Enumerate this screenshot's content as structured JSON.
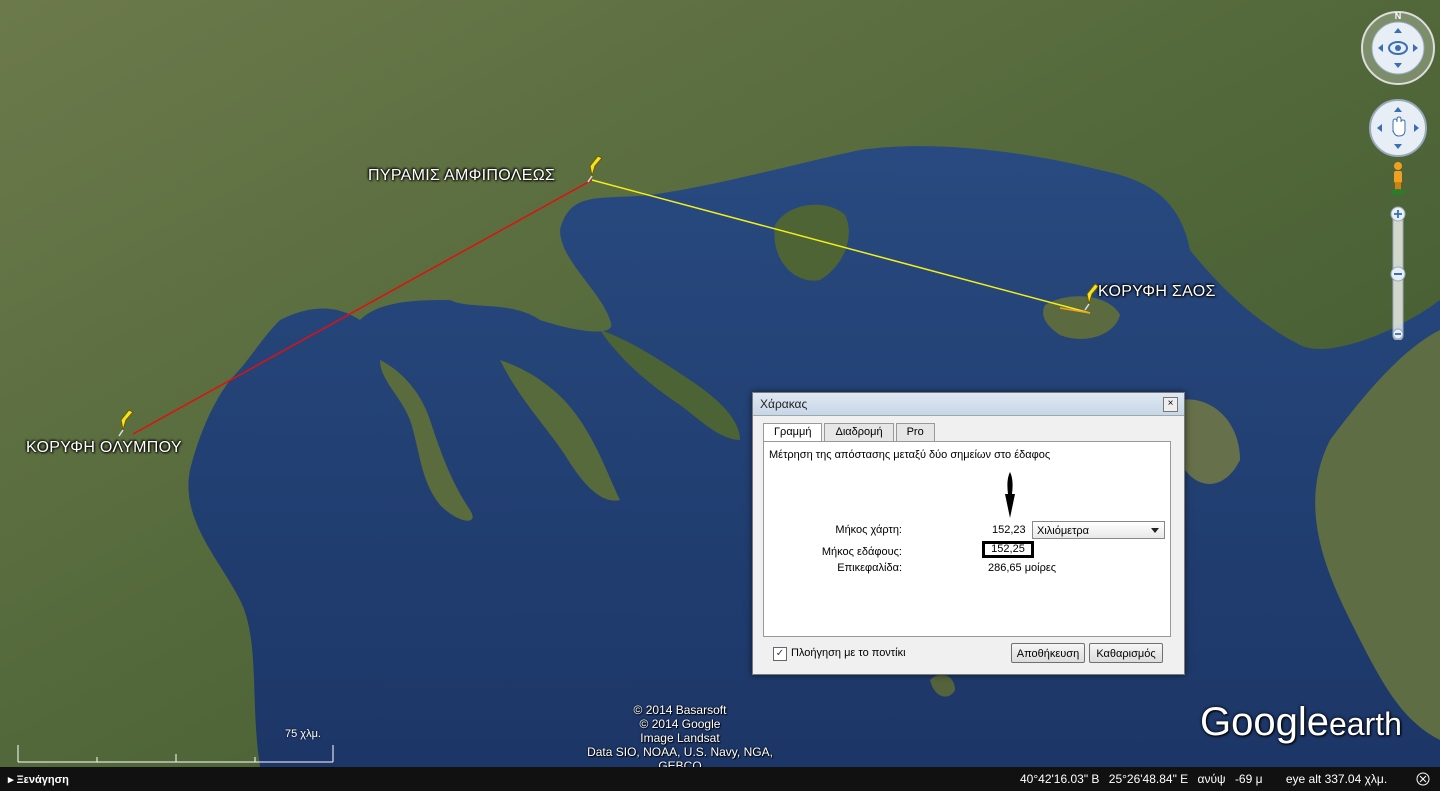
{
  "map": {
    "placemarks": [
      {
        "name": "ΠΥΡΑΜΙΣ ΑΜΦΙΠΟΛΕΩΣ"
      },
      {
        "name": "ΚΟΡΥΦΗ ΣΑΟΣ"
      },
      {
        "name": "ΚΟΡΥΦΗ ΟΛΥΜΠΟΥ"
      }
    ],
    "line_colors": {
      "olympus_amfipolis": "#e01010",
      "amfipolis_saos": "#f3ef1a"
    },
    "credits": [
      "© 2014 Basarsoft",
      "© 2014 Google",
      "Image Landsat",
      "Data SIO, NOAA, U.S. Navy, NGA, GEBCO"
    ],
    "logo": {
      "google": "Google",
      "earth": "earth"
    },
    "scale_label": "75 χλμ."
  },
  "ruler": {
    "title": "Χάρακας",
    "close": "×",
    "tabs": [
      "Γραμμή",
      "Διαδρομή",
      "Pro"
    ],
    "active_tab": "Γραμμή",
    "description": "Μέτρηση της απόστασης μεταξύ δύο σημείων στο έδαφος",
    "map_length_label": "Μήκος χάρτη:",
    "map_length_value": "152,23",
    "unit": "Χιλιόμετρα",
    "ground_length_label": "Μήκος εδάφους:",
    "ground_length_value": "152,25",
    "heading_label": "Επικεφαλίδα:",
    "heading_value": "286,65 μοίρες",
    "mouse_nav_label": "Πλοήγηση με το ποντίκι",
    "mouse_nav_checked": true,
    "save_button": "Αποθήκευση",
    "clear_button": "Καθαρισμός"
  },
  "status": {
    "tour": "▸ Ξενάγηση",
    "lat": "40°42'16.03\" Β",
    "lon": "25°26'48.84\" Ε",
    "elev_label": "ανύψ",
    "elev": "-69 μ",
    "eye_alt": "eye alt 337.04 χλμ."
  },
  "icons": [
    "look-joystick-icon",
    "move-joystick-icon",
    "pegman-icon",
    "zoom-in-icon",
    "zoom-out-icon",
    "placemark-pin-icon",
    "sound-icon"
  ]
}
